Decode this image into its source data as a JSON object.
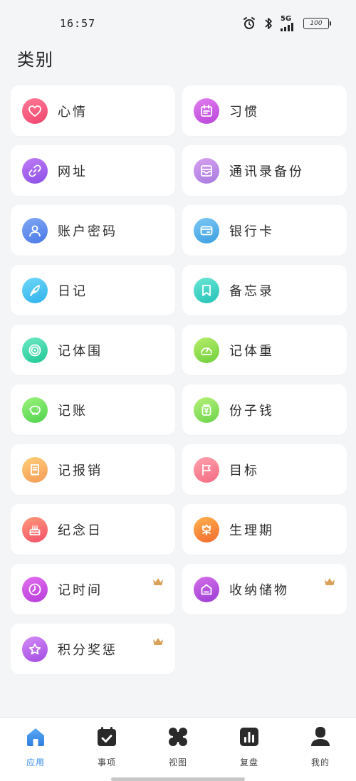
{
  "status_bar": {
    "time": "16:57",
    "network": "5G",
    "battery": "100"
  },
  "page": {
    "title": "类别"
  },
  "categories": [
    {
      "label": "心情",
      "icon": "heart-icon",
      "gradient": [
        "#ff7a95",
        "#f0456e"
      ],
      "premium": false
    },
    {
      "label": "习惯",
      "icon": "calendar-icon",
      "gradient": [
        "#e27ef0",
        "#b845d9"
      ],
      "premium": false
    },
    {
      "label": "网址",
      "icon": "link-icon",
      "gradient": [
        "#c07bf5",
        "#8a4fe6"
      ],
      "premium": false
    },
    {
      "label": "通讯录备份",
      "icon": "inbox-icon",
      "gradient": [
        "#d7a0ef",
        "#a77be0"
      ],
      "premium": false
    },
    {
      "label": "账户密码",
      "icon": "user-icon",
      "gradient": [
        "#7fa8f5",
        "#4a78e6"
      ],
      "premium": false
    },
    {
      "label": "银行卡",
      "icon": "card-icon",
      "gradient": [
        "#7cc9f5",
        "#3b9de0"
      ],
      "premium": false
    },
    {
      "label": "日记",
      "icon": "feather-icon",
      "gradient": [
        "#6fd7f7",
        "#2fb2ec"
      ],
      "premium": false
    },
    {
      "label": "备忘录",
      "icon": "bookmark-icon",
      "gradient": [
        "#6be6d4",
        "#22c2b8"
      ],
      "premium": false
    },
    {
      "label": "记体围",
      "icon": "target-icon",
      "gradient": [
        "#6ee9c4",
        "#1fc795"
      ],
      "premium": false
    },
    {
      "label": "记体重",
      "icon": "gauge-icon",
      "gradient": [
        "#b8ee6a",
        "#6fcf3c"
      ],
      "premium": false
    },
    {
      "label": "记账",
      "icon": "piggy-bank-icon",
      "gradient": [
        "#9bf27a",
        "#4fd34e"
      ],
      "premium": false
    },
    {
      "label": "份子钱",
      "icon": "money-jar-icon",
      "gradient": [
        "#b7f07a",
        "#6bd44a"
      ],
      "premium": false
    },
    {
      "label": "记报销",
      "icon": "receipt-icon",
      "gradient": [
        "#ffcf7a",
        "#f49a55"
      ],
      "premium": false
    },
    {
      "label": "目标",
      "icon": "flag-icon",
      "gradient": [
        "#ffa2ae",
        "#f36b80"
      ],
      "premium": false
    },
    {
      "label": "纪念日",
      "icon": "cake-icon",
      "gradient": [
        "#ff9a7a",
        "#f2506a"
      ],
      "premium": false
    },
    {
      "label": "生理期",
      "icon": "flower-icon",
      "gradient": [
        "#ffb14e",
        "#f26a2e"
      ],
      "premium": false
    },
    {
      "label": "记时间",
      "icon": "clock-icon",
      "gradient": [
        "#e36ff0",
        "#b63bd9"
      ],
      "premium": true
    },
    {
      "label": "收纳储物",
      "icon": "storage-icon",
      "gradient": [
        "#d56fe8",
        "#9b3dd6"
      ],
      "premium": true
    },
    {
      "label": "积分奖惩",
      "icon": "star-icon",
      "gradient": [
        "#d38bf5",
        "#a24be3"
      ],
      "premium": true
    }
  ],
  "bottom_nav": [
    {
      "label": "应用",
      "icon": "home-icon",
      "active": true
    },
    {
      "label": "事项",
      "icon": "calendar-check-icon",
      "active": false
    },
    {
      "label": "视图",
      "icon": "grid-petals-icon",
      "active": false
    },
    {
      "label": "复盘",
      "icon": "bar-chart-icon",
      "active": false
    },
    {
      "label": "我的",
      "icon": "profile-icon",
      "active": false
    }
  ],
  "colors": {
    "accent": "#3a8fe8",
    "crown": "#d9a15a",
    "background": "#f4f5f7"
  }
}
